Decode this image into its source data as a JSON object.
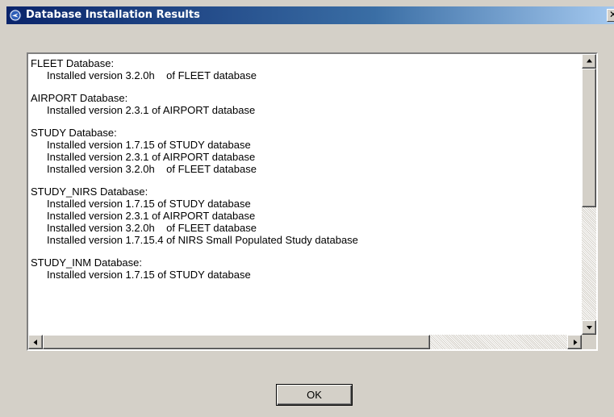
{
  "window": {
    "title": "Database Installation Results",
    "close_glyph": "✕"
  },
  "icons": {
    "app": "app-logo-icon",
    "close": "close-icon",
    "scroll_up": "arrow-up-icon",
    "scroll_down": "arrow-down-icon",
    "scroll_left": "arrow-left-icon",
    "scroll_right": "arrow-right-icon"
  },
  "results": {
    "groups": [
      {
        "header": "FLEET Database:",
        "lines": [
          "Installed version 3.2.0h    of FLEET database"
        ]
      },
      {
        "header": "AIRPORT Database:",
        "lines": [
          "Installed version 2.3.1 of AIRPORT database"
        ]
      },
      {
        "header": "STUDY Database:",
        "lines": [
          "Installed version 1.7.15 of STUDY database",
          "Installed version 2.3.1 of AIRPORT database",
          "Installed version 3.2.0h    of FLEET database"
        ]
      },
      {
        "header": "STUDY_NIRS Database:",
        "lines": [
          "Installed version 1.7.15 of STUDY database",
          "Installed version 2.3.1 of AIRPORT database",
          "Installed version 3.2.0h    of FLEET database",
          "Installed version 1.7.15.4 of NIRS Small Populated Study database"
        ]
      },
      {
        "header": "STUDY_INM Database:",
        "lines": [
          "Installed version 1.7.15 of STUDY database"
        ]
      }
    ]
  },
  "scroll": {
    "vertical_position": 0.0,
    "horizontal_position": 0.0
  },
  "buttons": {
    "ok_label": "OK"
  },
  "colors": {
    "titlebar_start": "#0a246a",
    "titlebar_end": "#a6caf0",
    "face": "#d4d0c8"
  }
}
